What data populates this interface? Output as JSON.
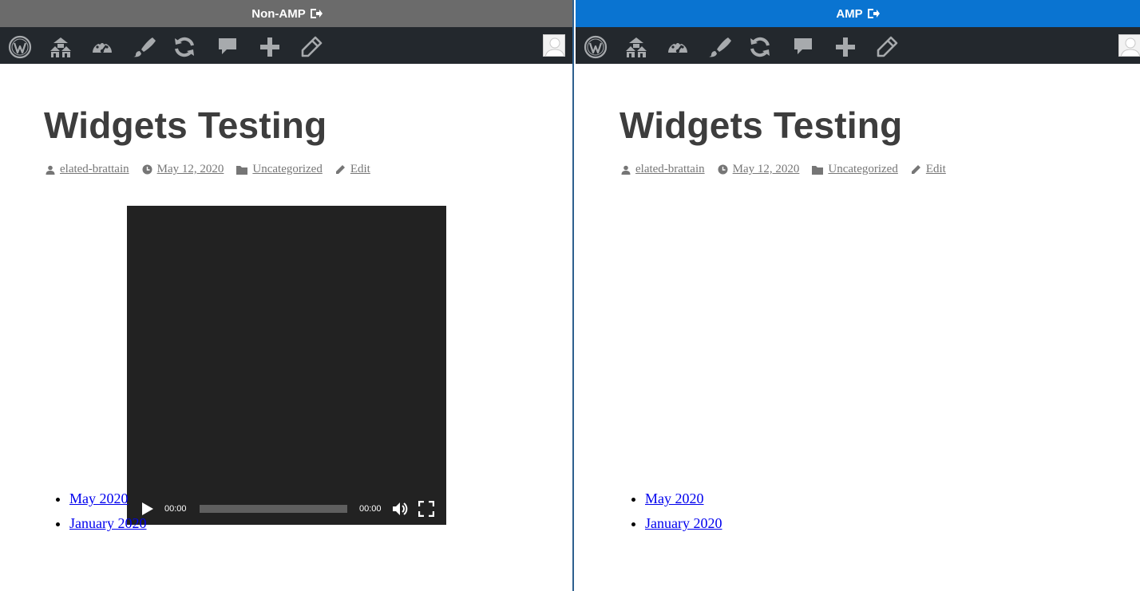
{
  "left_pane": {
    "mode_label": "Non-AMP",
    "mode_color": "#6b6b6b",
    "title": "Widgets Testing",
    "meta": {
      "author": "elated-brattain",
      "date": "May 12, 2020",
      "category": "Uncategorized",
      "edit": "Edit"
    },
    "video": {
      "current_time": "00:00",
      "duration": "00:00"
    },
    "archives": [
      "May 2020",
      "January 2020"
    ]
  },
  "right_pane": {
    "mode_label": "AMP",
    "mode_color": "#0a74d1",
    "title": "Widgets Testing",
    "meta": {
      "author": "elated-brattain",
      "date": "May 12, 2020",
      "category": "Uncategorized",
      "edit": "Edit"
    },
    "archives": [
      "May 2020",
      "January 2020"
    ]
  },
  "admin_bar_icons": [
    "wordpress-logo-icon",
    "multisite-icon",
    "dashboard-icon",
    "customize-icon",
    "updates-icon",
    "comments-icon",
    "new-content-icon",
    "edit-post-icon",
    "user-avatar"
  ]
}
